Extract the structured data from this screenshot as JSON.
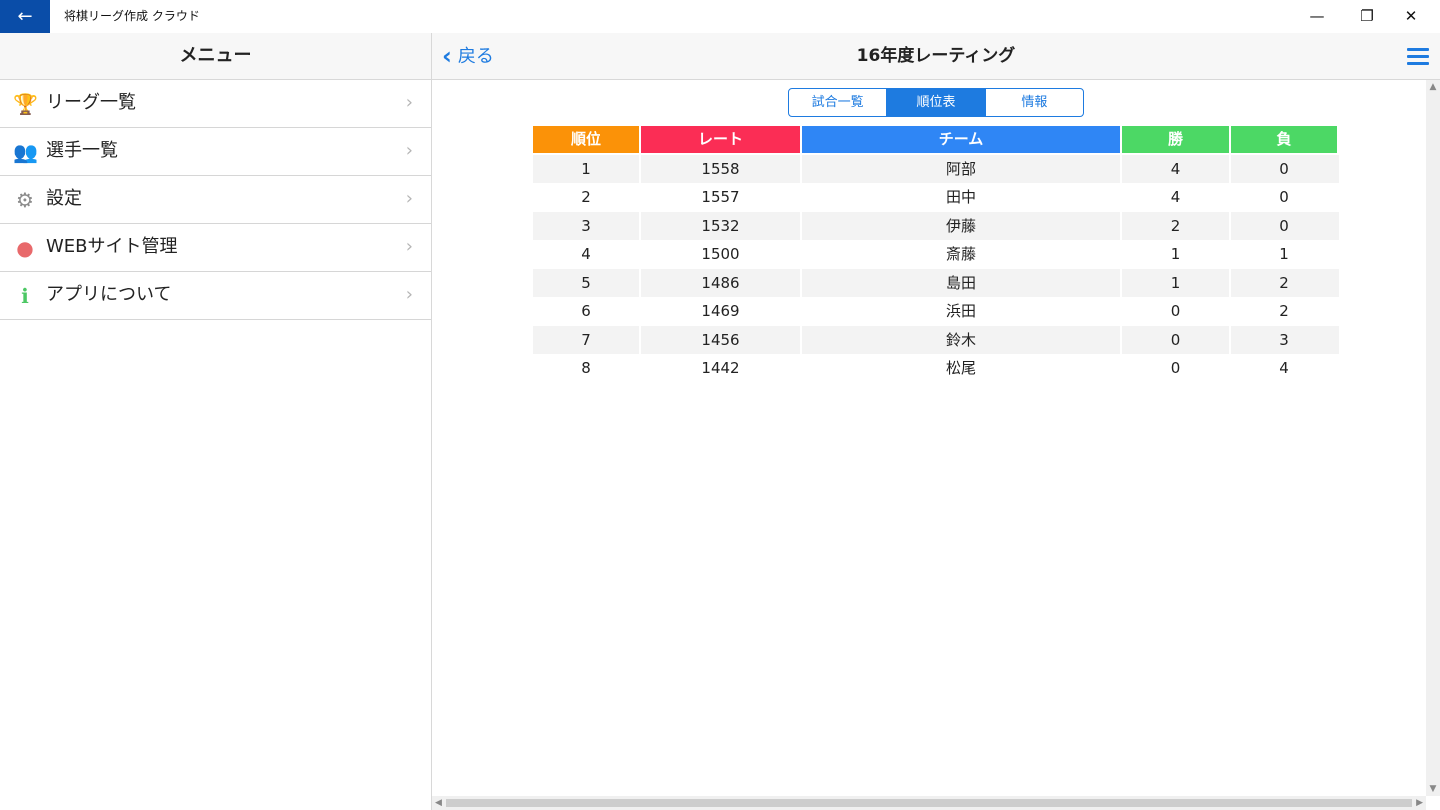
{
  "window": {
    "title": "将棋リーグ作成 クラウド",
    "back_glyph": "←",
    "min_glyph": "—",
    "max_glyph": "❐",
    "close_glyph": "✕"
  },
  "menu": {
    "title": "メニュー",
    "items": [
      {
        "label": "リーグ一覧",
        "icon": "trophy-icon",
        "icon_glyph": "🏆",
        "icon_color": "#1e7be0"
      },
      {
        "label": "選手一覧",
        "icon": "players-icon",
        "icon_glyph": "👥",
        "icon_color": "#f39c12"
      },
      {
        "label": "設定",
        "icon": "gear-icon",
        "icon_glyph": "⚙",
        "icon_color": "#8c8c8c"
      },
      {
        "label": "WEBサイト管理",
        "icon": "globe-icon",
        "icon_glyph": "●",
        "icon_color": "#e8696b"
      },
      {
        "label": "アプリについて",
        "icon": "info-icon",
        "icon_glyph": "ℹ",
        "icon_color": "#4cc764"
      }
    ],
    "chevron": "›"
  },
  "header": {
    "back_label": "戻る",
    "back_chevron": "‹",
    "title": "16年度レーティング"
  },
  "tabs": [
    {
      "label": "試合一覧",
      "active": false
    },
    {
      "label": "順位表",
      "active": true
    },
    {
      "label": "情報",
      "active": false
    }
  ],
  "table": {
    "headers": [
      {
        "label": "順位",
        "color": "#fb9208"
      },
      {
        "label": "レート",
        "color": "#fb2d55"
      },
      {
        "label": "チーム",
        "color": "#2f86f5"
      },
      {
        "label": "勝",
        "color": "#4cd865"
      },
      {
        "label": "負",
        "color": "#4cd865"
      }
    ],
    "rows": [
      [
        "1",
        "1558",
        "阿部",
        "4",
        "0"
      ],
      [
        "2",
        "1557",
        "田中",
        "4",
        "0"
      ],
      [
        "3",
        "1532",
        "伊藤",
        "2",
        "0"
      ],
      [
        "4",
        "1500",
        "斎藤",
        "1",
        "1"
      ],
      [
        "5",
        "1486",
        "島田",
        "1",
        "2"
      ],
      [
        "6",
        "1469",
        "浜田",
        "0",
        "2"
      ],
      [
        "7",
        "1456",
        "鈴木",
        "0",
        "3"
      ],
      [
        "8",
        "1442",
        "松尾",
        "0",
        "4"
      ]
    ]
  },
  "colors": {
    "accent": "#1e7be0",
    "titlebar_back": "#0a4da8"
  }
}
